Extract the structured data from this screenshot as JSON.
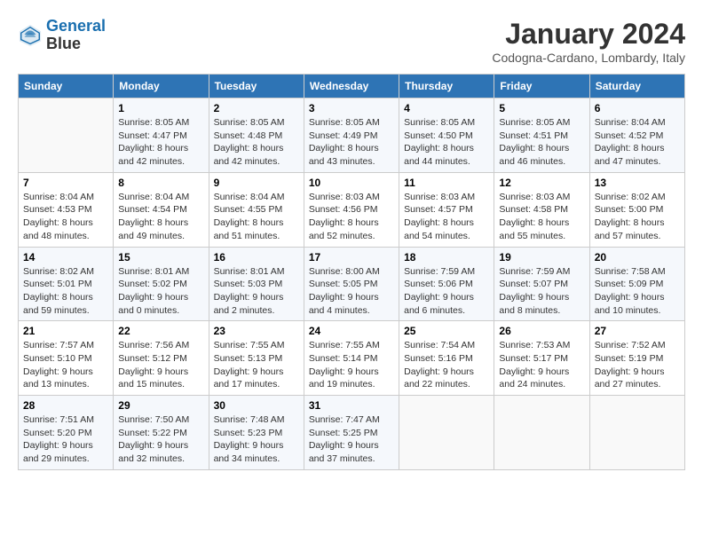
{
  "logo": {
    "line1": "General",
    "line2": "Blue"
  },
  "title": "January 2024",
  "subtitle": "Codogna-Cardano, Lombardy, Italy",
  "weekdays": [
    "Sunday",
    "Monday",
    "Tuesday",
    "Wednesday",
    "Thursday",
    "Friday",
    "Saturday"
  ],
  "weeks": [
    [
      {
        "day": "",
        "info": ""
      },
      {
        "day": "1",
        "info": "Sunrise: 8:05 AM\nSunset: 4:47 PM\nDaylight: 8 hours\nand 42 minutes."
      },
      {
        "day": "2",
        "info": "Sunrise: 8:05 AM\nSunset: 4:48 PM\nDaylight: 8 hours\nand 42 minutes."
      },
      {
        "day": "3",
        "info": "Sunrise: 8:05 AM\nSunset: 4:49 PM\nDaylight: 8 hours\nand 43 minutes."
      },
      {
        "day": "4",
        "info": "Sunrise: 8:05 AM\nSunset: 4:50 PM\nDaylight: 8 hours\nand 44 minutes."
      },
      {
        "day": "5",
        "info": "Sunrise: 8:05 AM\nSunset: 4:51 PM\nDaylight: 8 hours\nand 46 minutes."
      },
      {
        "day": "6",
        "info": "Sunrise: 8:04 AM\nSunset: 4:52 PM\nDaylight: 8 hours\nand 47 minutes."
      }
    ],
    [
      {
        "day": "7",
        "info": "Sunrise: 8:04 AM\nSunset: 4:53 PM\nDaylight: 8 hours\nand 48 minutes."
      },
      {
        "day": "8",
        "info": "Sunrise: 8:04 AM\nSunset: 4:54 PM\nDaylight: 8 hours\nand 49 minutes."
      },
      {
        "day": "9",
        "info": "Sunrise: 8:04 AM\nSunset: 4:55 PM\nDaylight: 8 hours\nand 51 minutes."
      },
      {
        "day": "10",
        "info": "Sunrise: 8:03 AM\nSunset: 4:56 PM\nDaylight: 8 hours\nand 52 minutes."
      },
      {
        "day": "11",
        "info": "Sunrise: 8:03 AM\nSunset: 4:57 PM\nDaylight: 8 hours\nand 54 minutes."
      },
      {
        "day": "12",
        "info": "Sunrise: 8:03 AM\nSunset: 4:58 PM\nDaylight: 8 hours\nand 55 minutes."
      },
      {
        "day": "13",
        "info": "Sunrise: 8:02 AM\nSunset: 5:00 PM\nDaylight: 8 hours\nand 57 minutes."
      }
    ],
    [
      {
        "day": "14",
        "info": "Sunrise: 8:02 AM\nSunset: 5:01 PM\nDaylight: 8 hours\nand 59 minutes."
      },
      {
        "day": "15",
        "info": "Sunrise: 8:01 AM\nSunset: 5:02 PM\nDaylight: 9 hours\nand 0 minutes."
      },
      {
        "day": "16",
        "info": "Sunrise: 8:01 AM\nSunset: 5:03 PM\nDaylight: 9 hours\nand 2 minutes."
      },
      {
        "day": "17",
        "info": "Sunrise: 8:00 AM\nSunset: 5:05 PM\nDaylight: 9 hours\nand 4 minutes."
      },
      {
        "day": "18",
        "info": "Sunrise: 7:59 AM\nSunset: 5:06 PM\nDaylight: 9 hours\nand 6 minutes."
      },
      {
        "day": "19",
        "info": "Sunrise: 7:59 AM\nSunset: 5:07 PM\nDaylight: 9 hours\nand 8 minutes."
      },
      {
        "day": "20",
        "info": "Sunrise: 7:58 AM\nSunset: 5:09 PM\nDaylight: 9 hours\nand 10 minutes."
      }
    ],
    [
      {
        "day": "21",
        "info": "Sunrise: 7:57 AM\nSunset: 5:10 PM\nDaylight: 9 hours\nand 13 minutes."
      },
      {
        "day": "22",
        "info": "Sunrise: 7:56 AM\nSunset: 5:12 PM\nDaylight: 9 hours\nand 15 minutes."
      },
      {
        "day": "23",
        "info": "Sunrise: 7:55 AM\nSunset: 5:13 PM\nDaylight: 9 hours\nand 17 minutes."
      },
      {
        "day": "24",
        "info": "Sunrise: 7:55 AM\nSunset: 5:14 PM\nDaylight: 9 hours\nand 19 minutes."
      },
      {
        "day": "25",
        "info": "Sunrise: 7:54 AM\nSunset: 5:16 PM\nDaylight: 9 hours\nand 22 minutes."
      },
      {
        "day": "26",
        "info": "Sunrise: 7:53 AM\nSunset: 5:17 PM\nDaylight: 9 hours\nand 24 minutes."
      },
      {
        "day": "27",
        "info": "Sunrise: 7:52 AM\nSunset: 5:19 PM\nDaylight: 9 hours\nand 27 minutes."
      }
    ],
    [
      {
        "day": "28",
        "info": "Sunrise: 7:51 AM\nSunset: 5:20 PM\nDaylight: 9 hours\nand 29 minutes."
      },
      {
        "day": "29",
        "info": "Sunrise: 7:50 AM\nSunset: 5:22 PM\nDaylight: 9 hours\nand 32 minutes."
      },
      {
        "day": "30",
        "info": "Sunrise: 7:48 AM\nSunset: 5:23 PM\nDaylight: 9 hours\nand 34 minutes."
      },
      {
        "day": "31",
        "info": "Sunrise: 7:47 AM\nSunset: 5:25 PM\nDaylight: 9 hours\nand 37 minutes."
      },
      {
        "day": "",
        "info": ""
      },
      {
        "day": "",
        "info": ""
      },
      {
        "day": "",
        "info": ""
      }
    ]
  ]
}
